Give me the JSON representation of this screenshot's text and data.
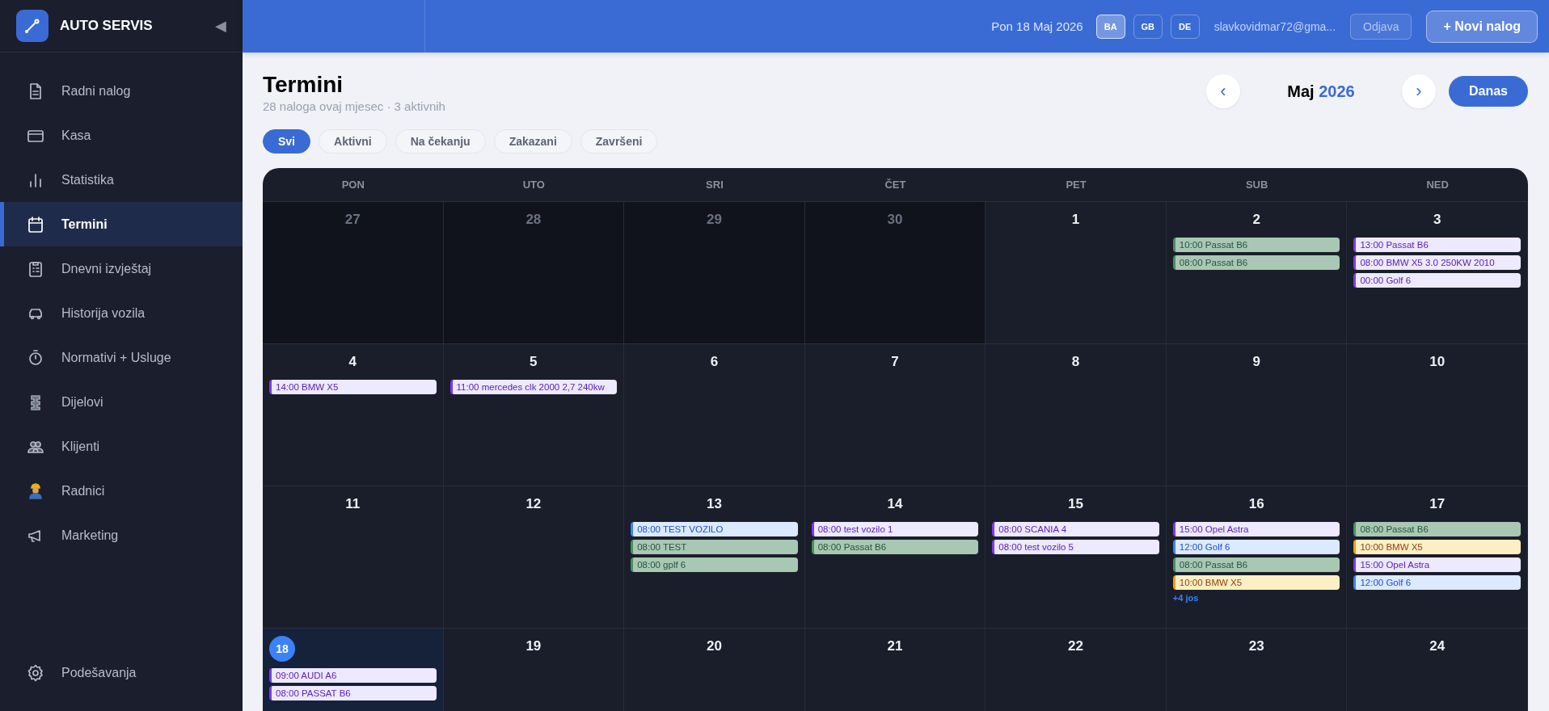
{
  "brand": {
    "title": "AUTO SERVIS",
    "collapse": "◀"
  },
  "sidebar": {
    "items": [
      {
        "label": "Radni nalog",
        "selected": false
      },
      {
        "label": "Kasa",
        "selected": false
      },
      {
        "label": "Statistika",
        "selected": false
      },
      {
        "label": "Termini",
        "selected": true
      },
      {
        "label": "Dnevni izvještaj",
        "selected": false
      },
      {
        "label": "Historija vozila",
        "selected": false
      },
      {
        "label": "Normativi + Usluge",
        "selected": false
      },
      {
        "label": "Dijelovi",
        "selected": false
      },
      {
        "label": "Klijenti",
        "selected": false
      },
      {
        "label": "Radnici",
        "selected": false
      },
      {
        "label": "Marketing",
        "selected": false
      }
    ],
    "footer": {
      "label": "Podešavanja",
      "selected": false
    }
  },
  "topbar": {
    "date": "Pon 18 Maj 2026",
    "languages": [
      {
        "label": "BA",
        "selected": true
      },
      {
        "label": "GB",
        "selected": false
      },
      {
        "label": "DE",
        "selected": false
      }
    ],
    "user": "slavkovidmar72@gma...",
    "logout": "Odjava",
    "new_order": "+ Novi nalog"
  },
  "page": {
    "title": "Termini",
    "subtitle": "28 naloga ovaj mjesec · 3 aktivnih",
    "prev": "‹",
    "month": "Maj",
    "year": "2026",
    "next": "›",
    "today_button": "Danas"
  },
  "filters": [
    {
      "label": "Svi",
      "selected": true
    },
    {
      "label": "Aktivni",
      "selected": false
    },
    {
      "label": "Na čekanju",
      "selected": false
    },
    {
      "label": "Zakazani",
      "selected": false
    },
    {
      "label": "Završeni",
      "selected": false
    }
  ],
  "calendar": {
    "weekdays": [
      "PON",
      "UTO",
      "SRI",
      "ČET",
      "PET",
      "SUB",
      "NED"
    ],
    "weeks": [
      [
        {
          "day": "27",
          "outside": true,
          "today": false
        },
        {
          "day": "28",
          "outside": true,
          "today": false
        },
        {
          "day": "29",
          "outside": true,
          "today": false
        },
        {
          "day": "30",
          "outside": true,
          "today": false
        },
        {
          "day": "1",
          "outside": false,
          "today": false
        },
        {
          "day": "2",
          "outside": false,
          "today": false,
          "events": [
            {
              "text": "10:00 Passat B6",
              "color": "#a9c8b3"
            },
            {
              "text": "08:00 Passat B6",
              "color": "#a9c8b3"
            }
          ]
        },
        {
          "day": "3",
          "outside": false,
          "today": false,
          "events": [
            {
              "text": "13:00 Passat B6",
              "color": "#ede9fe"
            },
            {
              "text": "08:00 BMW X5 3.0 250KW 2010",
              "color": "#ede9fe"
            },
            {
              "text": "00:00 Golf 6",
              "color": "#ede9fe"
            }
          ]
        }
      ],
      [
        {
          "day": "4",
          "outside": false,
          "today": false,
          "events": [
            {
              "text": "14:00 BMW X5",
              "color": "#ede9fe"
            }
          ]
        },
        {
          "day": "5",
          "outside": false,
          "today": false,
          "events": [
            {
              "text": "11:00 mercedes clk 2000 2,7 240kw",
              "color": "#ede9fe"
            }
          ]
        },
        {
          "day": "6",
          "outside": false,
          "today": false
        },
        {
          "day": "7",
          "outside": false,
          "today": false
        },
        {
          "day": "8",
          "outside": false,
          "today": false
        },
        {
          "day": "9",
          "outside": false,
          "today": false
        },
        {
          "day": "10",
          "outside": false,
          "today": false
        }
      ],
      [
        {
          "day": "11",
          "outside": false,
          "today": false
        },
        {
          "day": "12",
          "outside": false,
          "today": false
        },
        {
          "day": "13",
          "outside": false,
          "today": false,
          "events": [
            {
              "text": "08:00 TEST VOZILO",
              "color": "#dbeafe"
            },
            {
              "text": "08:00 TEST",
              "color": "#a9c8b3"
            },
            {
              "text": "08:00 gplf 6",
              "color": "#a9c8b3"
            }
          ]
        },
        {
          "day": "14",
          "outside": false,
          "today": false,
          "events": [
            {
              "text": "08:00 test vozilo 1",
              "color": "#ede9fe"
            },
            {
              "text": "08:00 Passat B6",
              "color": "#a9c8b3"
            }
          ]
        },
        {
          "day": "15",
          "outside": false,
          "today": false,
          "events": [
            {
              "text": "08:00 SCANIA 4",
              "color": "#ede9fe"
            },
            {
              "text": "08:00 test vozilo 5",
              "color": "#ede9fe"
            }
          ]
        },
        {
          "day": "16",
          "outside": false,
          "today": false,
          "events": [
            {
              "text": "15:00 Opel Astra",
              "color": "#ede9fe"
            },
            {
              "text": "12:00 Golf 6",
              "color": "#dbeafe"
            },
            {
              "text": "08:00 Passat B6",
              "color": "#a9c8b3"
            },
            {
              "text": "10:00 BMW X5",
              "color": "#fdefc4"
            }
          ],
          "more": "+4 jos"
        },
        {
          "day": "17",
          "outside": false,
          "today": false,
          "events": [
            {
              "text": "08:00 Passat B6",
              "color": "#a9c8b3"
            },
            {
              "text": "10:00 BMW X5",
              "color": "#fdefc4"
            },
            {
              "text": "15:00 Opel Astra",
              "color": "#ede9fe"
            },
            {
              "text": "12:00 Golf 6",
              "color": "#dbeafe"
            }
          ]
        }
      ],
      [
        {
          "day": "18",
          "outside": false,
          "today": true,
          "events": [
            {
              "text": "09:00 AUDI A6",
              "color": "#ede9fe"
            },
            {
              "text": "08:00 PASSAT B6",
              "color": "#ede9fe"
            }
          ]
        },
        {
          "day": "19",
          "outside": false,
          "today": false
        },
        {
          "day": "20",
          "outside": false,
          "today": false
        },
        {
          "day": "21",
          "outside": false,
          "today": false
        },
        {
          "day": "22",
          "outside": false,
          "today": false
        },
        {
          "day": "23",
          "outside": false,
          "today": false
        },
        {
          "day": "24",
          "outside": false,
          "today": false
        }
      ]
    ]
  }
}
